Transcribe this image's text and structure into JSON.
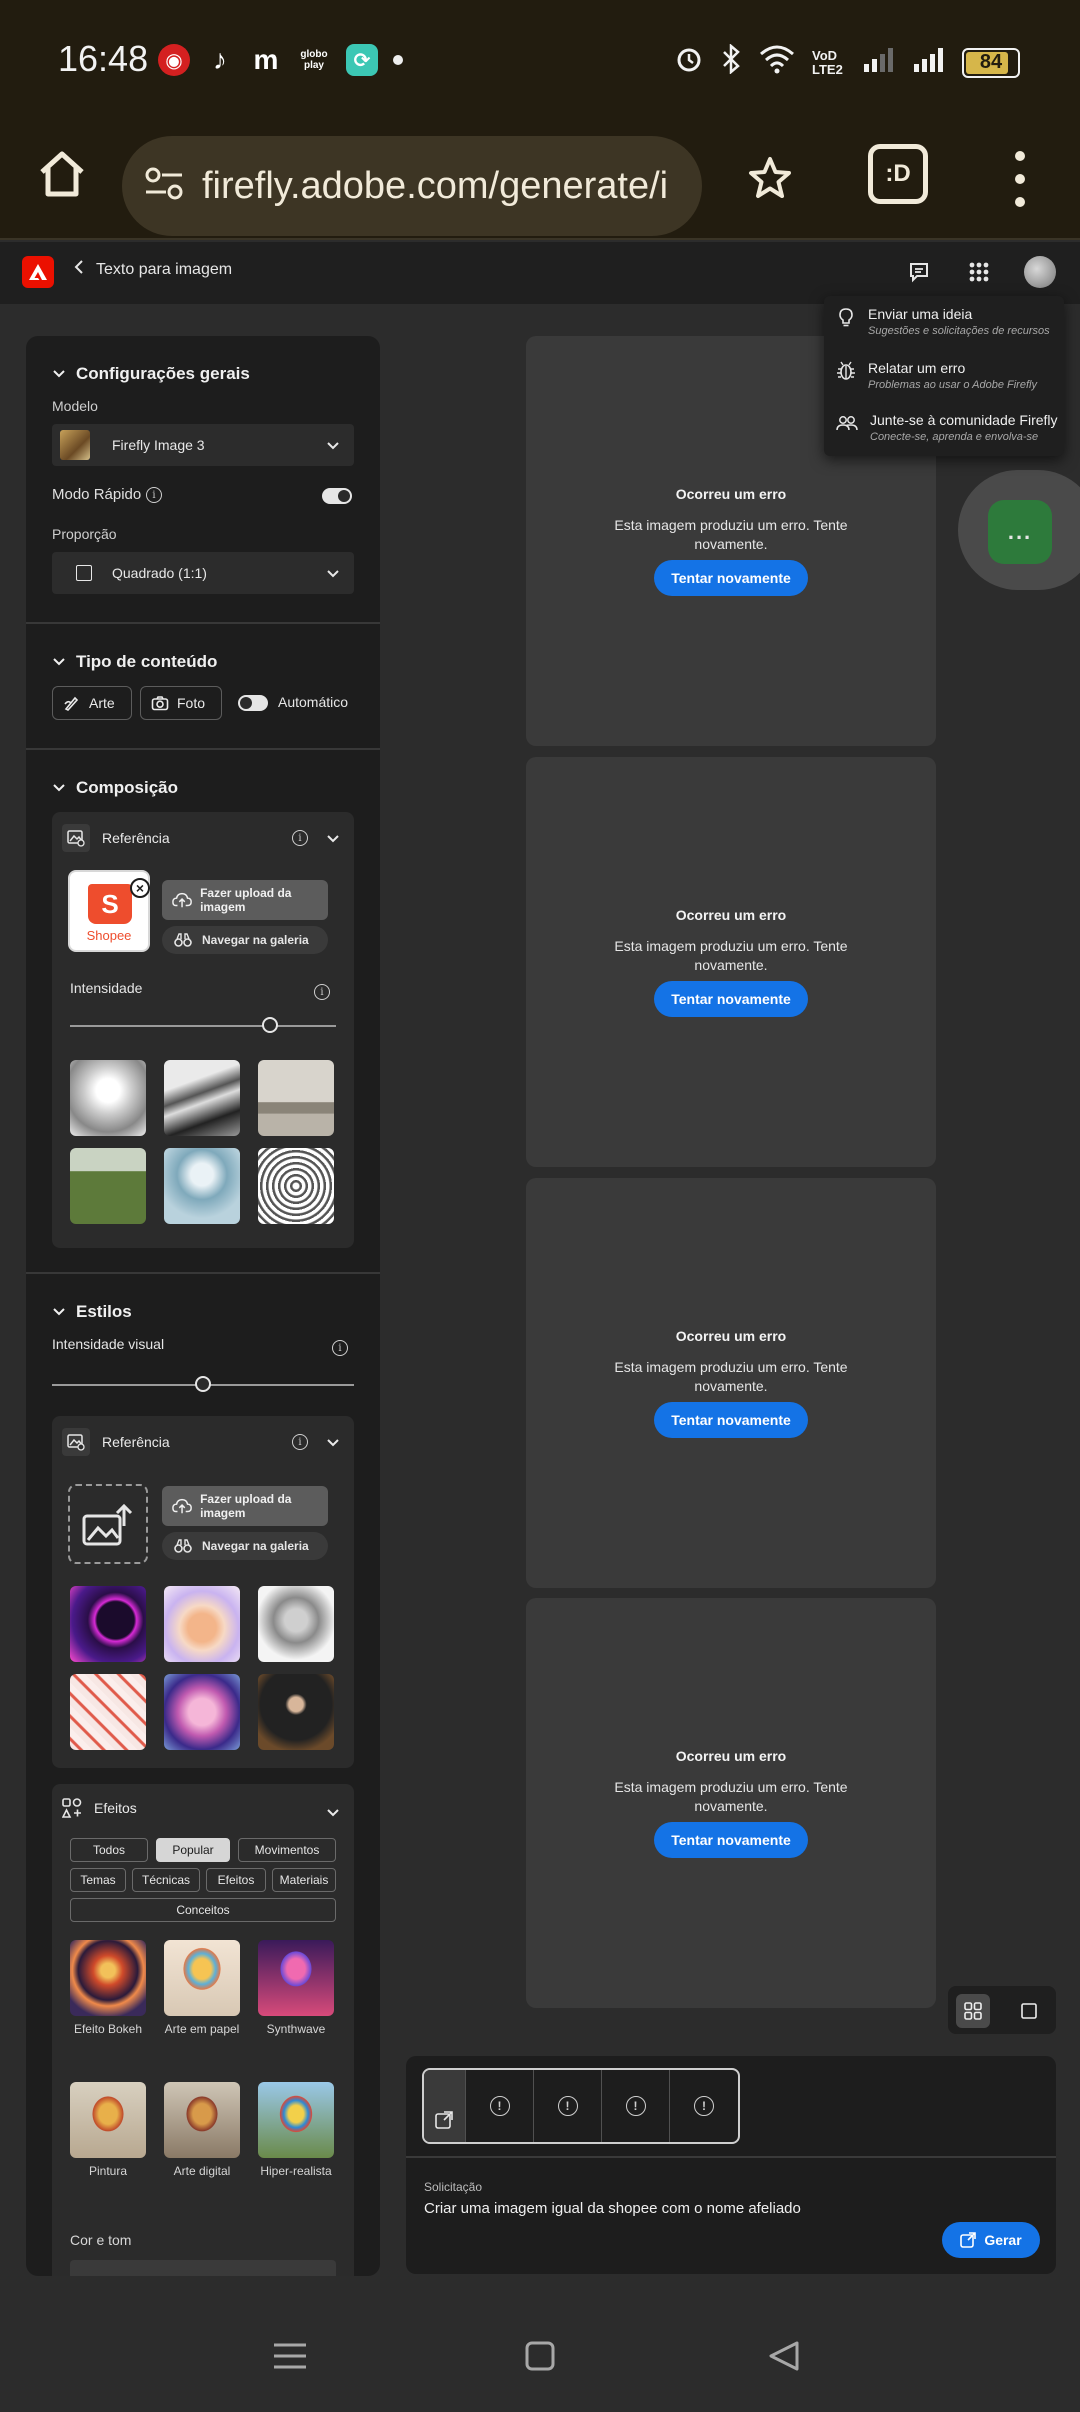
{
  "status_bar": {
    "time": "16:48",
    "battery": "84",
    "battery_level": 0.84,
    "network": "VoD LTE2",
    "app_icons": [
      "podcast-icon",
      "tiktok-icon",
      "m-icon",
      "globoplay-icon",
      "app-icon",
      "dot-icon"
    ],
    "globoplay_label": "globo play"
  },
  "browser": {
    "url": "firefly.adobe.com/generate/i",
    "tab_switcher": ":D"
  },
  "header": {
    "back_label": "Texto para imagem"
  },
  "dropdown": {
    "items": [
      {
        "title": "Enviar uma ideia",
        "subtitle": "Sugestões e solicitações de recursos",
        "icon": "lightbulb-icon"
      },
      {
        "title": "Relatar um erro",
        "subtitle": "Problemas ao usar o Adobe Firefly",
        "icon": "bug-icon"
      },
      {
        "title": "Junte-se à comunidade Firefly",
        "subtitle": "Conecte-se, aprenda e envolva-se",
        "icon": "community-icon"
      }
    ]
  },
  "general": {
    "title": "Configurações gerais",
    "model_label": "Modelo",
    "model_value": "Firefly Image 3",
    "fast_mode_label": "Modo Rápido",
    "fast_mode_on": true,
    "ratio_label": "Proporção",
    "ratio_value": "Quadrado (1:1)"
  },
  "content_type": {
    "title": "Tipo de conteúdo",
    "art": "Arte",
    "photo": "Foto",
    "auto": "Automático"
  },
  "composition": {
    "title": "Composição",
    "reference_label": "Referência",
    "uploaded_brand": "Shopee",
    "upload_label": "Fazer upload da imagem",
    "gallery_label": "Navegar na galeria",
    "intensity_label": "Intensidade",
    "intensity_value": 0.75
  },
  "styles": {
    "title": "Estilos",
    "visual_intensity_label": "Intensidade visual",
    "visual_intensity_value": 0.5,
    "reference_label": "Referência",
    "upload_label": "Fazer upload da imagem",
    "gallery_label": "Navegar na galeria"
  },
  "effects": {
    "title": "Efeitos",
    "filters_row1": [
      "Todos",
      "Popular",
      "Movimentos"
    ],
    "filters_row2": [
      "Temas",
      "Técnicas",
      "Efeitos",
      "Materiais"
    ],
    "filters_row3": [
      "Conceitos"
    ],
    "active_filter": "Popular",
    "items": [
      "Efeito Bokeh",
      "Arte em papel",
      "Synthwave",
      "Pintura",
      "Arte digital",
      "Hiper-realista"
    ],
    "color_tone_label": "Cor e tom"
  },
  "cards": [
    {
      "title": "Ocorreu um erro",
      "text": "Esta imagem produziu um erro. Tente novamente.",
      "retry": "Tentar novamente"
    },
    {
      "title": "Ocorreu um erro",
      "text": "Esta imagem produziu um erro. Tente novamente.",
      "retry": "Tentar novamente"
    },
    {
      "title": "Ocorreu um erro",
      "text": "Esta imagem produziu um erro. Tente novamente.",
      "retry": "Tentar novamente"
    },
    {
      "title": "Ocorreu um erro",
      "text": "Esta imagem produziu um erro. Tente novamente.",
      "retry": "Tentar novamente"
    }
  ],
  "fab": {
    "label": "..."
  },
  "prompt": {
    "label": "Solicitação",
    "text": "Criar uma imagem igual da shopee com o nome afeliado",
    "generate": "Gerar"
  },
  "colors": {
    "accent": "#1473e6",
    "adobe_red": "#eb1000",
    "panel": "#1d1d1d",
    "card": "#3a3a3a"
  }
}
